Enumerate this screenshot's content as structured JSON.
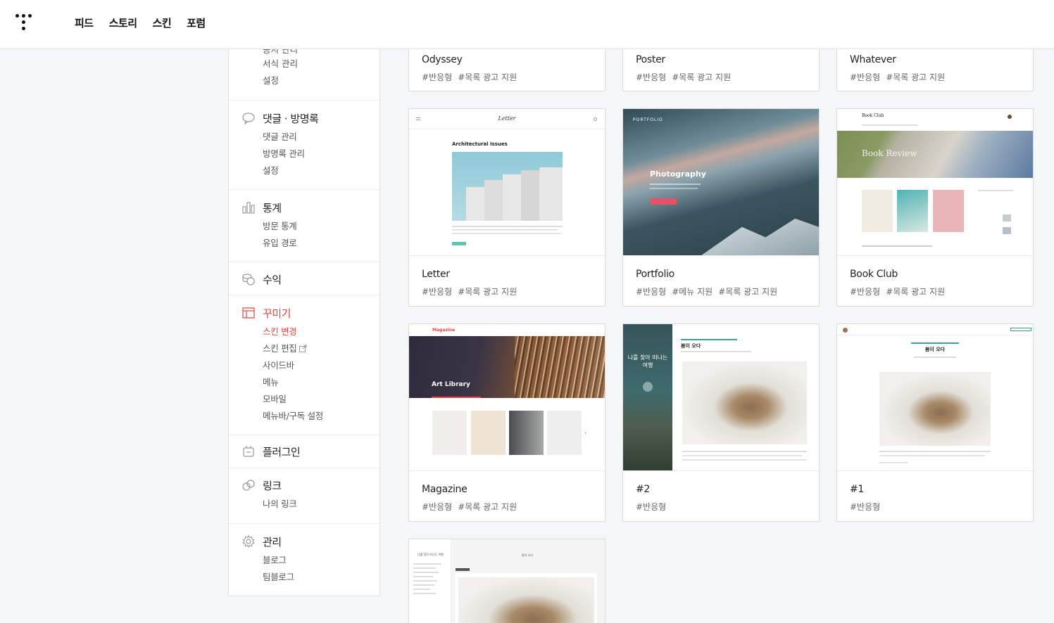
{
  "nav": [
    "피드",
    "스토리",
    "스킨",
    "포럼"
  ],
  "sidebar": {
    "top_cut": "공지 관리",
    "top_items": [
      "서식 관리",
      "설정"
    ],
    "sections": [
      {
        "label": "댓글 · 방명록",
        "icon": "comment-icon",
        "items": [
          "댓글 관리",
          "방명록 관리",
          "설정"
        ]
      },
      {
        "label": "통계",
        "icon": "chart-icon",
        "items": [
          "방문 통계",
          "유입 경로"
        ]
      },
      {
        "label": "수익",
        "icon": "coins-icon",
        "items": []
      },
      {
        "label": "꾸미기",
        "icon": "layout-icon",
        "items": [
          "스킨 변경",
          "스킨 편집",
          "사이드바",
          "메뉴",
          "모바일",
          "메뉴바/구독 설정"
        ],
        "active": true
      },
      {
        "label": "플러그인",
        "icon": "plug-icon",
        "items": []
      },
      {
        "label": "링크",
        "icon": "link-icon",
        "items": [
          "나의 링크"
        ]
      },
      {
        "label": "관리",
        "icon": "gear-icon",
        "items": [
          "블로그",
          "팀블로그"
        ]
      }
    ]
  },
  "skins": [
    {
      "name": "Odyssey",
      "tags": [
        "#반응형",
        "#목록 광고 지원"
      ]
    },
    {
      "name": "Poster",
      "tags": [
        "#반응형",
        "#목록 광고 지원"
      ]
    },
    {
      "name": "Whatever",
      "tags": [
        "#반응형",
        "#목록 광고 지원"
      ]
    },
    {
      "name": "Letter",
      "tags": [
        "#반응형",
        "#목록 광고 지원"
      ]
    },
    {
      "name": "Portfolio",
      "tags": [
        "#반응형",
        "#메뉴 지원",
        "#목록 광고 지원"
      ]
    },
    {
      "name": "Book Club",
      "tags": [
        "#반응형",
        "#목록 광고 지원"
      ]
    },
    {
      "name": "Magazine",
      "tags": [
        "#반응형",
        "#목록 광고 지원"
      ]
    },
    {
      "name": "#2",
      "tags": [
        "#반응형"
      ]
    },
    {
      "name": "#1",
      "tags": [
        "#반응형"
      ]
    }
  ],
  "previews": {
    "letter_logo": "Letter",
    "letter_heading": "Architectural Issues",
    "portfolio_label": "PORTFOLIO",
    "portfolio_heading": "Photography",
    "bookclub_logo": "Book Club",
    "bookclub_banner": "Book Review",
    "magazine_logo": "Magazine",
    "magazine_banner": "Art Library",
    "skin2_side": "나를 찾아 떠나는 여행",
    "skin2_title": "봄이 오다",
    "skin1_title": "봄이 오다",
    "skin0_title": "봄이 오다",
    "skin0_side": "나를 찾아 떠나는 여행"
  },
  "colors": {
    "accent": "#e4443a",
    "portfolio_btn": "#e8506a",
    "letter_btn": "#5cc4b3"
  }
}
